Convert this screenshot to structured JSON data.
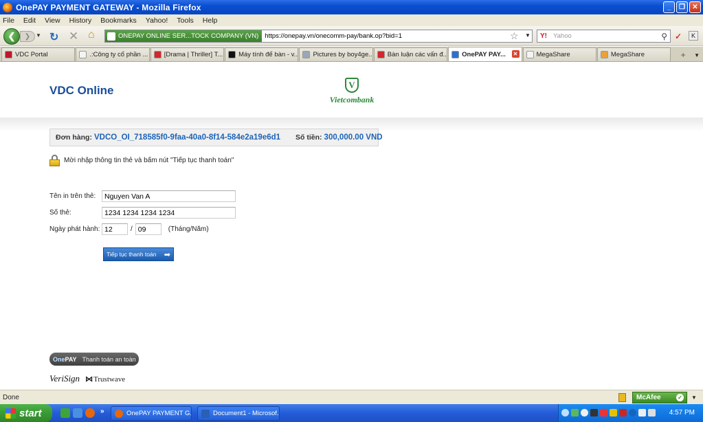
{
  "window": {
    "title": "OnePAY PAYMENT GATEWAY - Mozilla Firefox",
    "controls": [
      "_",
      "❐",
      "✕"
    ]
  },
  "menu": [
    "File",
    "Edit",
    "View",
    "History",
    "Bookmarks",
    "Yahoo!",
    "Tools",
    "Help"
  ],
  "navbar": {
    "identity": "ONEPAY ONLINE SER...TOCK COMPANY (VN)",
    "url": "https://onepay.vn/onecomm-pay/bank.op?bid=1",
    "search_placeholder": "Yahoo",
    "search_engine": "Y!"
  },
  "tabs": [
    {
      "label": "VDC Portal",
      "icon_color": "#c0182b",
      "active": false
    },
    {
      "label": ".:Công ty cổ phần ...",
      "icon_color": "#f4f4f4",
      "active": false
    },
    {
      "label": "[Drama | Thriller] T...",
      "icon_color": "#d4262c",
      "active": false
    },
    {
      "label": "Máy tính để bàn - v...",
      "icon_color": "#111111",
      "active": false
    },
    {
      "label": "Pictures by boy4ge...",
      "icon_color": "#9aa7b8",
      "active": false
    },
    {
      "label": "Bàn luận các vấn đ...",
      "icon_color": "#d4262c",
      "active": false
    },
    {
      "label": "OnePAY PAY...",
      "icon_color": "#2d6fcf",
      "active": true
    },
    {
      "label": "MegaShare",
      "icon_color": "#f4f4f4",
      "active": false
    },
    {
      "label": "MegaShare",
      "icon_color": "#e8a23a",
      "active": false
    }
  ],
  "page": {
    "merchant": "VDC Online",
    "bank_emblem": "V",
    "bank_name": "Vietcombank",
    "order_label": "Đơn hàng:",
    "order_id": "VDCO_OI_718585f0-9faa-40a0-8f14-584e2a19e6d1",
    "amount_label": "Số tiền:",
    "amount": "300,000.00 VND",
    "instruction": "Mời nhập thông tin thẻ và bấm nút \"Tiếp tục thanh toán\"",
    "fields": {
      "name_label": "Tên in trên thẻ:",
      "name_value": "Nguyen Van A",
      "card_label": "Số thẻ:",
      "card_value": "1234 1234 1234 1234",
      "date_label": "Ngày phát hành:",
      "month_value": "12",
      "date_separator": "/",
      "year_value": "09",
      "date_hint": "(Tháng/Năm)"
    },
    "continue_button": "Tiếp tục thanh toán",
    "onepay_one": "One",
    "onepay_pay": "PAY",
    "onepay_secure": "Thanh toán an toàn",
    "verisign": "VeriSign",
    "trustwave": "Trustwave"
  },
  "status": {
    "text": "Done",
    "mcafee": "McAfee"
  },
  "taskbar": {
    "start": "start",
    "tasks": [
      {
        "label": "OnePAY PAYMENT G...",
        "icon_color": "#e8670b"
      },
      {
        "label": "Document1 - Microsof...",
        "icon_color": "#2b5fb4"
      }
    ],
    "more": "»",
    "clock": "4:57 PM"
  }
}
